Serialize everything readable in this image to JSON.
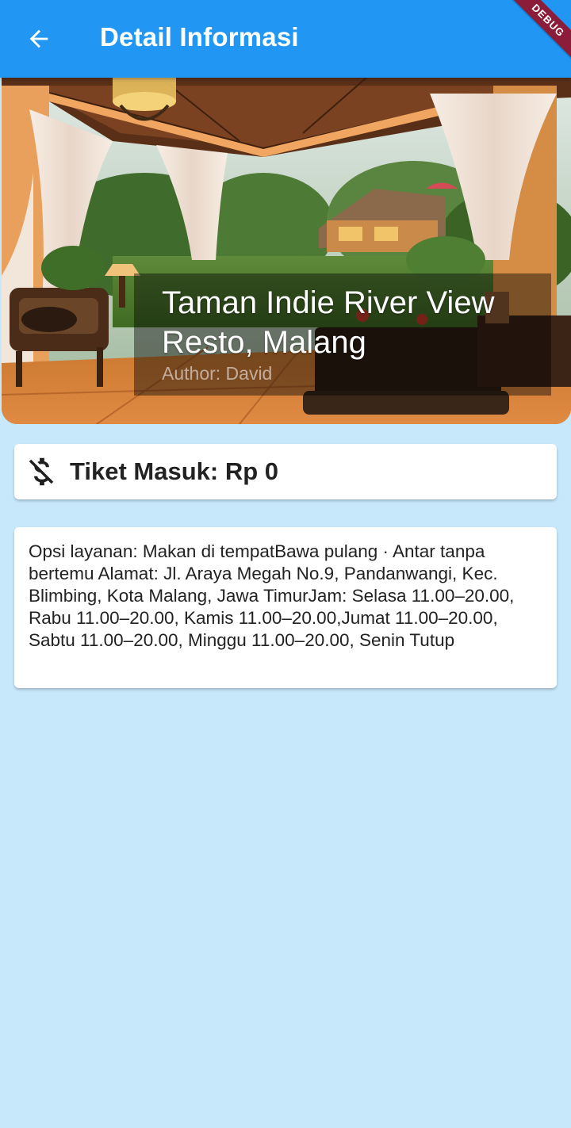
{
  "appbar": {
    "title": "Detail Informasi",
    "back_icon": "arrow-left-icon",
    "debug_banner": "DEBUG",
    "color": "#2196F3"
  },
  "hero": {
    "title": "Taman Indie River View Resto, Malang",
    "author": "Author: David"
  },
  "ticket": {
    "icon": "money-off-icon",
    "label": "Tiket Masuk: Rp 0"
  },
  "info": {
    "text": "Opsi layanan: Makan di tempatBawa pulang · Antar tanpa bertemu Alamat: Jl. Araya Megah No.9, Pandanwangi, Kec. Blimbing, Kota Malang, Jawa TimurJam: Selasa 11.00–20.00, Rabu 11.00–20.00, Kamis 11.00–20.00,Jumat 11.00–20.00, Sabtu 11.00–20.00, Minggu 11.00–20.00, Senin Tutup"
  },
  "colors": {
    "background": "#C7E8FB",
    "card": "#FFFFFF",
    "text": "#222222"
  }
}
